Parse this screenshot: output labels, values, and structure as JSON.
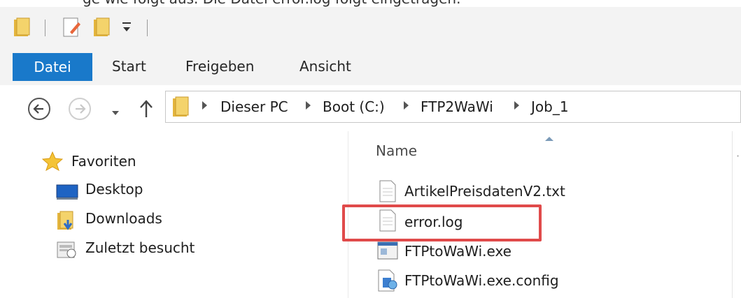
{
  "top_strip_text": "ge wie folgt aus. Die Datei error.log folgt eingetragen.",
  "ribbon": {
    "tabs": [
      "Datei",
      "Start",
      "Freigeben",
      "Ansicht"
    ]
  },
  "address": {
    "breadcrumbs": [
      "Dieser PC",
      "Boot (C:)",
      "FTP2WaWi",
      "Job_1"
    ]
  },
  "navigation": {
    "favorites_label": "Favoriten",
    "items": [
      "Desktop",
      "Downloads",
      "Zuletzt besucht"
    ]
  },
  "file_list": {
    "column_name": "Name",
    "files": [
      {
        "name": "ArtikelPreisdatenV2.txt",
        "icon": "text-file-icon"
      },
      {
        "name": "error.log",
        "icon": "log-file-icon",
        "highlighted": true
      },
      {
        "name": "FTPtoWaWi.exe",
        "icon": "exe-file-icon"
      },
      {
        "name": "FTPtoWaWi.exe.config",
        "icon": "config-file-icon"
      }
    ]
  },
  "colors": {
    "accent": "#1979ca",
    "highlight_border": "#e04a4a",
    "ribbon_bg": "#f3f3f3"
  }
}
